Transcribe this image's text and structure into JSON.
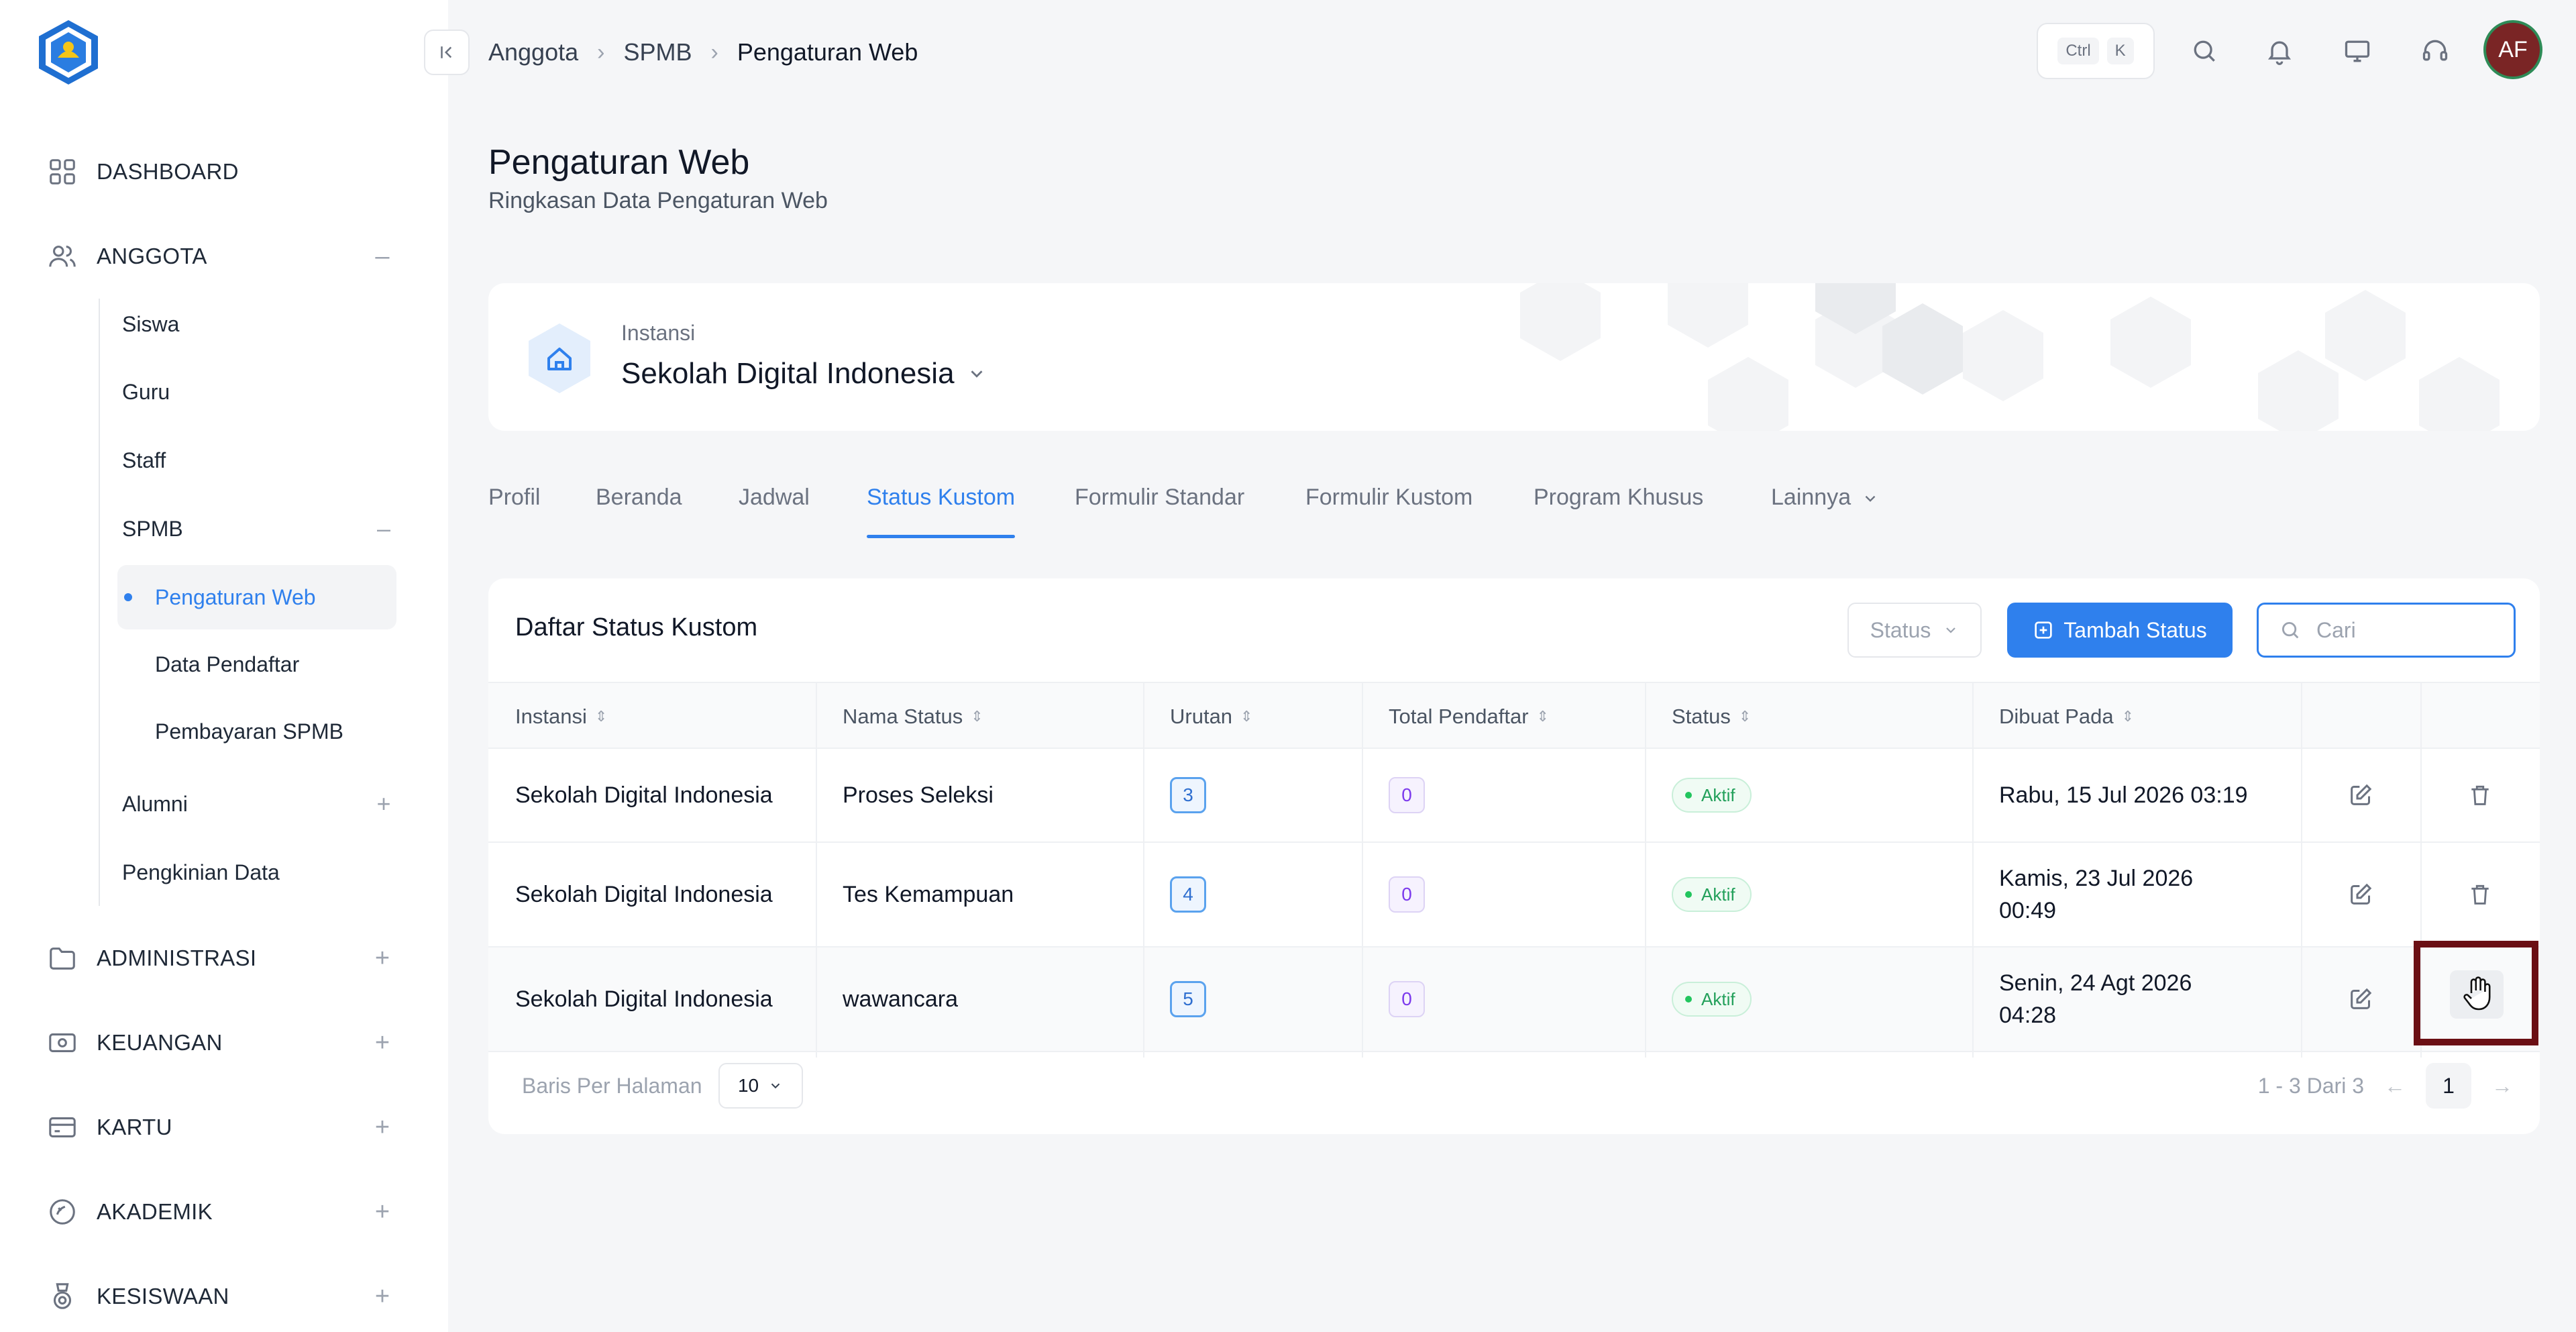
{
  "breadcrumb": [
    "Anggota",
    "SPMB",
    "Pengaturan Web"
  ],
  "shortcut": {
    "key1": "Ctrl",
    "key2": "K"
  },
  "user": {
    "initials": "AF"
  },
  "sidebar": {
    "top": [
      {
        "label": "DASHBOARD",
        "icon": "grid-icon"
      },
      {
        "label": "ANGGOTA",
        "icon": "users-icon",
        "toggle": "–"
      }
    ],
    "anggota_items": [
      {
        "label": "Siswa"
      },
      {
        "label": "Guru"
      },
      {
        "label": "Staff"
      },
      {
        "label": "SPMB",
        "toggle": "–"
      }
    ],
    "spmb_items": [
      {
        "label": "Pengaturan Web",
        "active": true
      },
      {
        "label": "Data Pendaftar"
      },
      {
        "label": "Pembayaran SPMB"
      }
    ],
    "anggota_more": [
      {
        "label": "Alumni",
        "toggle": "+"
      },
      {
        "label": "Pengkinian Data"
      }
    ],
    "bottom": [
      {
        "label": "ADMINISTRASI",
        "icon": "folder-icon",
        "toggle": "+"
      },
      {
        "label": "KEUANGAN",
        "icon": "money-icon",
        "toggle": "+"
      },
      {
        "label": "KARTU",
        "icon": "card-icon",
        "toggle": "+"
      },
      {
        "label": "AKADEMIK",
        "icon": "academic-icon",
        "toggle": "+"
      },
      {
        "label": "KESISWAAN",
        "icon": "medal-icon",
        "toggle": "+"
      }
    ]
  },
  "page": {
    "title": "Pengaturan Web",
    "subtitle": "Ringkasan Data Pengaturan Web"
  },
  "instansi": {
    "label": "Instansi",
    "name": "Sekolah Digital Indonesia"
  },
  "tabs": [
    "Profil",
    "Beranda",
    "Jadwal",
    "Status Kustom",
    "Formulir Standar",
    "Formulir Kustom",
    "Program Khusus",
    "Lainnya"
  ],
  "active_tab": "Status Kustom",
  "table": {
    "title": "Daftar Status Kustom",
    "status_filter": "Status",
    "add_button": "Tambah Status",
    "search_placeholder": "Cari",
    "columns": [
      "Instansi",
      "Nama Status",
      "Urutan",
      "Total Pendaftar",
      "Status",
      "Dibuat Pada"
    ],
    "rows": [
      {
        "instansi": "Sekolah Digital Indonesia",
        "nama": "Proses Seleksi",
        "urutan": "3",
        "total": "0",
        "status": "Aktif",
        "dibuat_1": "Rabu, 15 Jul 2026 03:19",
        "dibuat_2": ""
      },
      {
        "instansi": "Sekolah Digital Indonesia",
        "nama": "Tes Kemampuan",
        "urutan": "4",
        "total": "0",
        "status": "Aktif",
        "dibuat_1": "Kamis, 23 Jul 2026",
        "dibuat_2": "00:49"
      },
      {
        "instansi": "Sekolah Digital Indonesia",
        "nama": "wawancara",
        "urutan": "5",
        "total": "0",
        "status": "Aktif",
        "dibuat_1": "Senin, 24 Agt 2026",
        "dibuat_2": "04:28"
      }
    ],
    "rows_label": "Baris Per Halaman",
    "rows_value": "10",
    "range_text": "1 - 3 Dari 3",
    "page": "1"
  }
}
